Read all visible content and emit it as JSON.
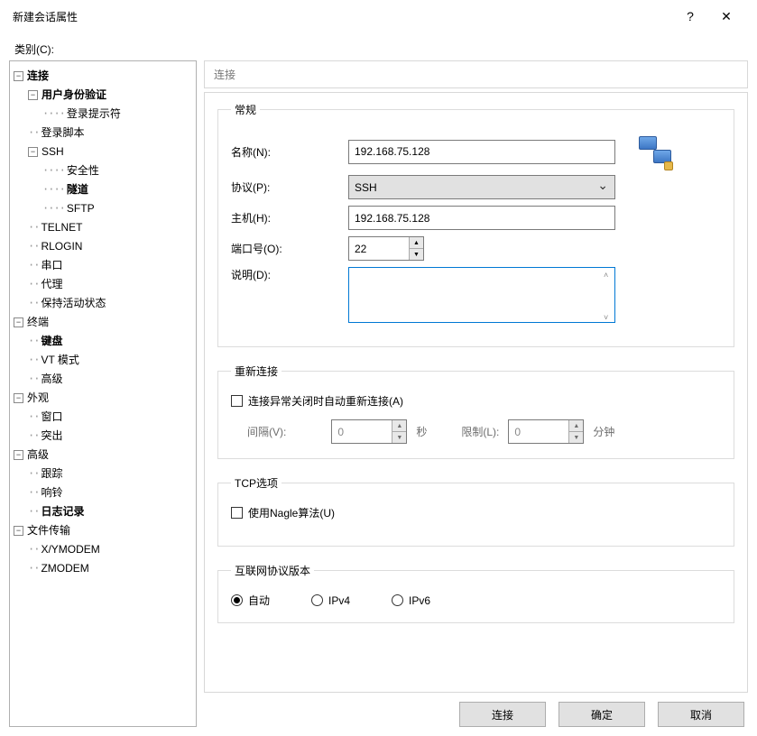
{
  "window": {
    "title": "新建会话属性",
    "help": "?",
    "close": "✕"
  },
  "category_label": "类别(C):",
  "tree": {
    "connection": "连接",
    "user_auth": "用户身份验证",
    "login_prompt": "登录提示符",
    "login_script": "登录脚本",
    "ssh": "SSH",
    "security": "安全性",
    "tunnel": "隧道",
    "sftp": "SFTP",
    "telnet": "TELNET",
    "rlogin": "RLOGIN",
    "serial": "串口",
    "proxy": "代理",
    "keepalive": "保持活动状态",
    "terminal": "终端",
    "keyboard": "键盘",
    "vt_mode": "VT 模式",
    "advanced_term": "高级",
    "appearance": "外观",
    "window": "窗口",
    "highlight": "突出",
    "advanced": "高级",
    "trace": "跟踪",
    "bell": "响铃",
    "logging": "日志记录",
    "file_transfer": "文件传输",
    "xymodem": "X/YMODEM",
    "zmodem": "ZMODEM"
  },
  "right": {
    "header": "连接",
    "general": {
      "legend": "常规",
      "name_label": "名称(N):",
      "name_value": "192.168.75.128",
      "protocol_label": "协议(P):",
      "protocol_value": "SSH",
      "host_label": "主机(H):",
      "host_value": "192.168.75.128",
      "port_label": "端口号(O):",
      "port_value": "22",
      "desc_label": "说明(D):",
      "desc_value": ""
    },
    "reconnect": {
      "legend": "重新连接",
      "checkbox_label": "连接异常关闭时自动重新连接(A)",
      "interval_label": "间隔(V):",
      "interval_value": "0",
      "interval_unit": "秒",
      "limit_label": "限制(L):",
      "limit_value": "0",
      "limit_unit": "分钟"
    },
    "tcp": {
      "legend": "TCP选项",
      "nagle_label": "使用Nagle算法(U)"
    },
    "ipver": {
      "legend": "互联网协议版本",
      "auto": "自动",
      "ipv4": "IPv4",
      "ipv6": "IPv6"
    }
  },
  "buttons": {
    "connect": "连接",
    "ok": "确定",
    "cancel": "取消"
  }
}
